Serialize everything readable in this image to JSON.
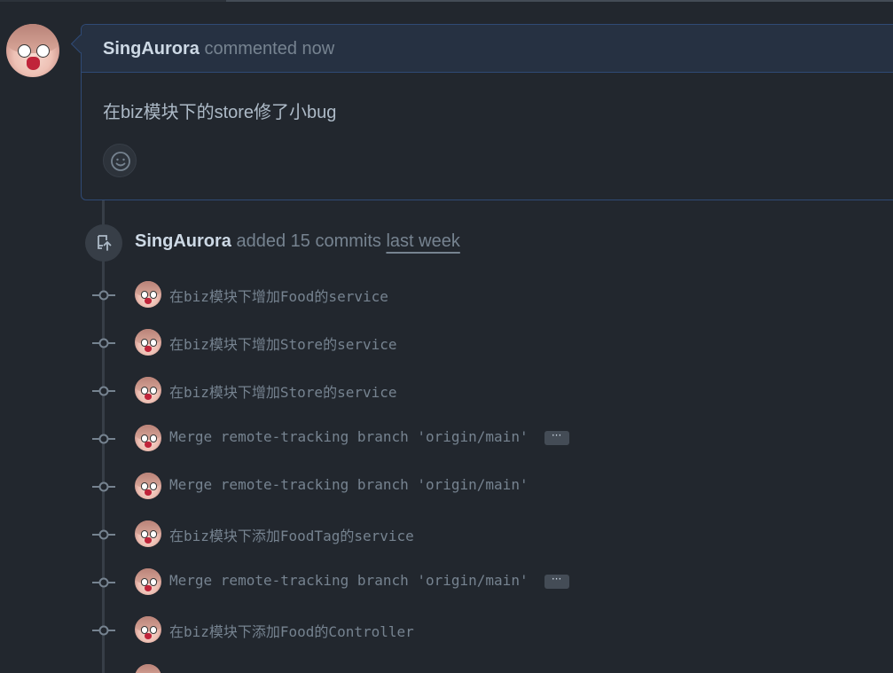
{
  "comment": {
    "author": "SingAurora",
    "action": "commented now",
    "body": "在biz模块下的store修了小bug"
  },
  "push_event": {
    "author": "SingAurora",
    "action": "added 15 commits",
    "time": "last week"
  },
  "commits": [
    {
      "message": "在biz模块下增加Food的service",
      "has_ellipsis": false
    },
    {
      "message": "在biz模块下增加Store的service",
      "has_ellipsis": false
    },
    {
      "message": "在biz模块下增加Store的service",
      "has_ellipsis": false
    },
    {
      "message": "Merge remote-tracking branch 'origin/main'",
      "has_ellipsis": true
    },
    {
      "message": "Merge remote-tracking branch 'origin/main'",
      "has_ellipsis": false
    },
    {
      "message": "在biz模块下添加FoodTag的service",
      "has_ellipsis": false
    },
    {
      "message": "Merge remote-tracking branch 'origin/main'",
      "has_ellipsis": true
    },
    {
      "message": "在biz模块下添加Food的Controller",
      "has_ellipsis": false
    }
  ],
  "ellipsis_label": "···",
  "icons": {
    "reaction": "smiley-icon",
    "push": "repo-push-icon",
    "commit": "git-commit-icon"
  },
  "colors": {
    "background": "#22272e",
    "comment_border": "#2f4a75",
    "header_bg": "#263142",
    "text": "#adbac7",
    "muted": "#768390",
    "author": "#cdd9e5"
  }
}
